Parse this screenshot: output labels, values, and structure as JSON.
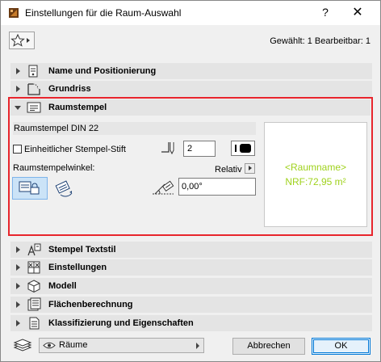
{
  "window": {
    "title": "Einstellungen für die Raum-Auswahl",
    "help_label": "?",
    "close_label": "✕"
  },
  "selection_info": "Gewählt: 1 Bearbeitbar: 1",
  "panels": [
    {
      "label": "Name und Positionierung",
      "icon": "name-position-icon",
      "expanded": false
    },
    {
      "label": "Grundriss",
      "icon": "floor-plan-icon",
      "expanded": false
    },
    {
      "label": "Raumstempel",
      "icon": "zone-stamp-icon",
      "expanded": true
    },
    {
      "label": "Stempel Textstil",
      "icon": "text-style-icon",
      "expanded": false
    },
    {
      "label": "Einstellungen",
      "icon": "settings-icon",
      "expanded": false
    },
    {
      "label": "Modell",
      "icon": "model-cube-icon",
      "expanded": false
    },
    {
      "label": "Flächenberechnung",
      "icon": "area-calculation-icon",
      "expanded": false
    },
    {
      "label": "Klassifizierung und Eigenschaften",
      "icon": "classification-icon",
      "expanded": false
    }
  ],
  "stamp": {
    "name": "Raumstempel DIN 22",
    "uniform_pen_label": "Einheitlicher Stempel-Stift",
    "uniform_pen_checked": false,
    "pen_value": "2",
    "angle_label": "Raumstempelwinkel:",
    "relative_label": "Relativ",
    "angle_value": "0,00°",
    "preview_line1": "<Raumname>",
    "preview_line2": "NRF:72,95 m²"
  },
  "footer": {
    "layer_value": "Räume",
    "cancel_label": "Abbrechen",
    "ok_label": "OK"
  },
  "colors": {
    "highlight_border": "#e8252c",
    "preview_text": "#9fd21c",
    "selected_button": "#cbe3f7"
  }
}
